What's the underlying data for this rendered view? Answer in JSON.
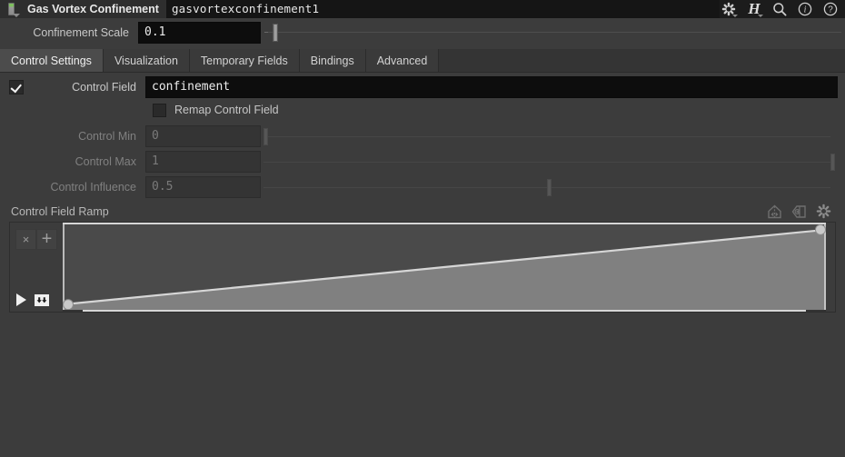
{
  "titlebar": {
    "node_icon": "node-icon",
    "label": "Gas Vortex Confinement",
    "value": "gasvortexconfinement1",
    "icons": [
      {
        "name": "gear-asterisk-icon",
        "glyph": "asterisk",
        "caret": true
      },
      {
        "name": "houdini-h-icon",
        "glyph": "H",
        "caret": true
      },
      {
        "name": "search-icon",
        "glyph": "magnifier",
        "caret": false
      },
      {
        "name": "info-icon",
        "glyph": "info",
        "caret": false
      },
      {
        "name": "help-icon",
        "glyph": "question",
        "caret": false
      }
    ]
  },
  "scale": {
    "label": "Confinement Scale",
    "value": "0.1",
    "slider_percent": 1.5
  },
  "tabs": [
    {
      "label": "Control Settings",
      "active": true
    },
    {
      "label": "Visualization",
      "active": false
    },
    {
      "label": "Temporary Fields",
      "active": false
    },
    {
      "label": "Bindings",
      "active": false
    },
    {
      "label": "Advanced",
      "active": false
    }
  ],
  "params": {
    "control_field": {
      "label": "Control Field",
      "value": "confinement",
      "checkbox_checked": true,
      "enabled": true
    },
    "remap": {
      "label": "Remap Control Field",
      "checked": false
    },
    "control_min": {
      "label": "Control Min",
      "value": "0",
      "enabled": false,
      "slider_percent": 0.0
    },
    "control_max": {
      "label": "Control Max",
      "value": "1",
      "enabled": false,
      "slider_percent": 100.0
    },
    "control_influence": {
      "label": "Control Influence",
      "value": "0.5",
      "enabled": false,
      "slider_percent": 50.0
    }
  },
  "ramp": {
    "title": "Control Field Ramp",
    "tools": [
      {
        "name": "flip-vertical-icon"
      },
      {
        "name": "flip-horizontal-icon"
      },
      {
        "name": "ramp-options-gear-icon"
      }
    ],
    "delete_point_label": "×",
    "add_point_label": "+",
    "points": [
      {
        "position": 0.0,
        "value": 0.08
      },
      {
        "position": 1.0,
        "value": 0.92
      }
    ],
    "colors": {
      "line": "#d6d6d6",
      "fill_below": "#808080",
      "fill_above": "#4a4a4a",
      "handle": "#c9c9c9"
    }
  },
  "theme": {
    "background": "#3c3c3c",
    "titlebar_bg": "#1c1c1c",
    "field_bg": "#0d0d0d",
    "accent_text": "#e8e8e8",
    "dim_text": "#808080",
    "tab_active_bg": "#4c4c4c"
  }
}
